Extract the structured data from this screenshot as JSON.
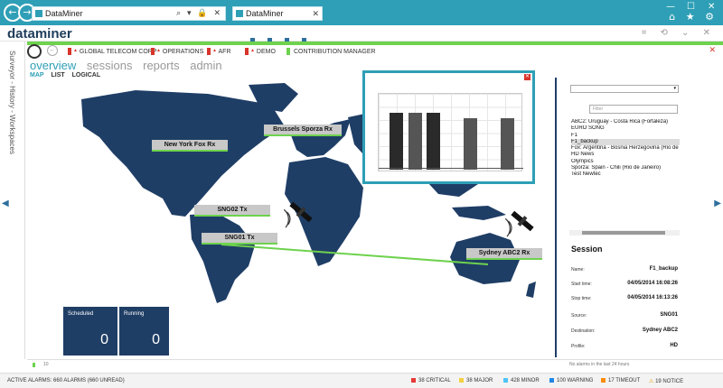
{
  "browser": {
    "url": "DataMiner",
    "tab": "DataMiner",
    "url_tools": "⌕ ▾ 🔒 ✕",
    "tab_close": "✕",
    "window_controls": [
      "—",
      "☐",
      "✕"
    ],
    "ie_icons": "⌂ ★ ⚙"
  },
  "app": {
    "logo": "dataminer",
    "top_icons": "⌗ ⟲ ⌄ ✕",
    "left_vertical_text": "Surveyor - History - Workspaces"
  },
  "breadcrumb": [
    {
      "label": "GLOBAL TELECOM CORP",
      "flag": "red"
    },
    {
      "label": "OPERATIONS",
      "flag": "red"
    },
    {
      "label": "AFR",
      "flag": "red"
    },
    {
      "label": "DEMO",
      "flag": "red"
    },
    {
      "label": "CONTRIBUTION MANAGER",
      "flag": "green"
    }
  ],
  "tabs": {
    "overview": "overview",
    "sessions": "sessions",
    "reports": "reports",
    "admin": "admin"
  },
  "subtabs": {
    "map": "MAP",
    "list": "LIST",
    "logical": "LOGICAL"
  },
  "map_labels": {
    "ny": "New York Fox Rx",
    "brussels": "Brussels Sporza Rx",
    "sng02": "SNG02 Tx",
    "sng01": "SNG01 Tx",
    "sydney": "Sydney ABC2 Rx"
  },
  "chart_data": {
    "type": "bar",
    "values": [
      0.72,
      0.72,
      0.72,
      0.0,
      0.65,
      0.0,
      0.65
    ],
    "colors": [
      "#2a2a2a",
      "#555555",
      "#2a2a2a",
      "#ffffff",
      "#555555",
      "#ffffff",
      "#555555"
    ],
    "ylim": [
      0,
      1
    ]
  },
  "counters": {
    "scheduled_label": "Scheduled",
    "scheduled": "0",
    "running_label": "Running",
    "running": "0"
  },
  "right_panel": {
    "dropdown_arrow": "▾",
    "filter_placeholder": "Filter",
    "sessions": [
      "ABC2: Uruguay - Costa Rica (Fortaleza)",
      "EURO SONG",
      "F1",
      "F1_backup",
      "Fox: Argentina - Bosnia Herzegovina (Rio de Ja",
      "HD News",
      "Olympics",
      "Sporza: Spain - Chili (Rio de Janeiro)",
      "Test Newtec"
    ],
    "selected_index": 3,
    "session": {
      "title": "Session",
      "name_label": "Name:",
      "name": "F1_backup",
      "start_label": "Start time:",
      "start": "04/05/2014 16:08:26",
      "stop_label": "Stop time:",
      "stop": "04/05/2014 16:13:26",
      "source_label": "Source:",
      "source": "SNG01",
      "destination_label": "Destination:",
      "destination": "Sydney ABC2",
      "profile_label": "Profile:",
      "profile": "HD"
    }
  },
  "status": {
    "strip_left": "10",
    "no_alarms": "No alarms in the last 24 hours",
    "active_alarms": "ACTIVE ALARMS: 660 ALARMS (660 UNREAD)",
    "critical": "38 CRITICAL",
    "major": "38 MAJOR",
    "minor": "428 MINOR",
    "warning": "100 WARNING",
    "timeout": "17 TIMEOUT",
    "notice": "19 NOTICE",
    "colors": {
      "critical": "#e53935",
      "major": "#f4d03f",
      "minor": "#4fc3f7",
      "warning": "#1e88e5",
      "timeout": "#fb8c00",
      "notice": "#9e9e9e"
    }
  }
}
